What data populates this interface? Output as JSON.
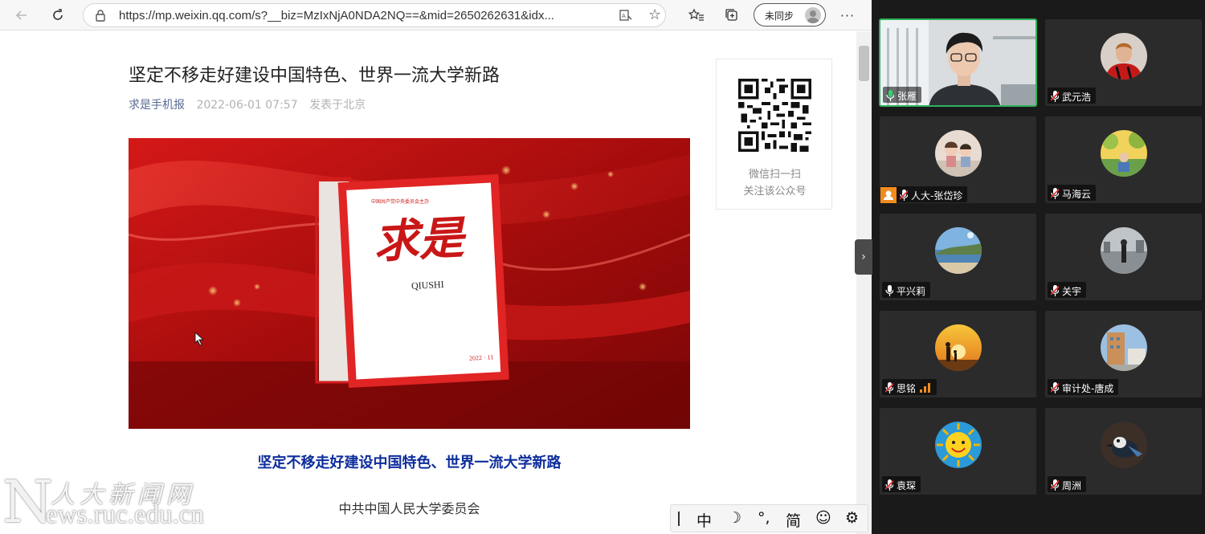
{
  "browser": {
    "url": "https://mp.weixin.qq.com/s?__biz=MzIxNjA0NDA2NQ==&mid=2650262631&idx...",
    "sync_label": "未同步",
    "icons": [
      "back-icon",
      "refresh-icon",
      "lock-icon",
      "reader-mode-icon",
      "favorite-star-icon",
      "favorites-list-icon",
      "collections-icon",
      "profile-avatar-icon",
      "more-icon"
    ]
  },
  "article": {
    "title": "坚定不移走好建设中国特色、世界一流大学新路",
    "source": "求是手机报",
    "date": "2022-06-01 07:57",
    "location": "发表于北京",
    "subtitle": "坚定不移走好建设中国特色、世界一流大学新路",
    "author": "中共中国人民大学委员会",
    "cover": {
      "logo_text": "求是",
      "logo_pinyin": "QIUSHI",
      "issue": "2022 · 11",
      "header_line": "中国共产党中央委员会主办"
    }
  },
  "qr_panel": {
    "line1": "微信扫一扫",
    "line2": "关注该公众号"
  },
  "ime": {
    "items": [
      "中",
      "☽",
      "°,",
      "简",
      "☺",
      "⚙"
    ]
  },
  "watermark": {
    "letter": "N",
    "chinese": "人大新闻网",
    "url": "ews.ruc.edu.cn"
  },
  "meeting": {
    "participants": [
      {
        "name": "张雁",
        "mic": "on",
        "speaking": true
      },
      {
        "name": "武元浩",
        "mic": "off"
      },
      {
        "name": "人大-张岱珍",
        "mic": "off",
        "badge": "user-icon"
      },
      {
        "name": "马海云",
        "mic": "off"
      },
      {
        "name": "平兴莉",
        "mic": "on"
      },
      {
        "name": "关宇",
        "mic": "off"
      },
      {
        "name": "思铭",
        "mic": "off",
        "signal": true
      },
      {
        "name": "审计处-唐成",
        "mic": "off"
      },
      {
        "name": "袁琛",
        "mic": "off"
      },
      {
        "name": "周洲",
        "mic": "off"
      }
    ]
  }
}
